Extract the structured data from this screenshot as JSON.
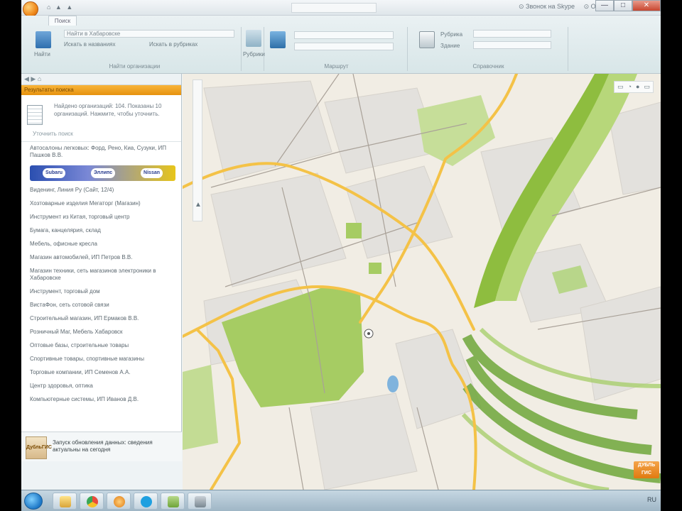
{
  "window": {
    "title": "",
    "quick_access": "⌂ ▲ ▲",
    "skype_controls": [
      "⊙ Звонок на Skype",
      "⊙ Отправить SMS"
    ],
    "buttons": {
      "minimize": "—",
      "maximize": "□",
      "close": "✕"
    }
  },
  "ribbon": {
    "tab_label": "Поиск",
    "groups": [
      {
        "label": "Найти организации",
        "button": "Найти",
        "field": "Найти в Хабаровске",
        "checkbox_1": "Искать в названиях",
        "checkbox_2": "Искать в рубриках"
      },
      {
        "label": "Рубрики",
        "button": "Рубрики"
      },
      {
        "label": "Маршрут",
        "button": "Маршрут",
        "field_from": "",
        "field_to": ""
      },
      {
        "label": "Справочник",
        "button": "Справка",
        "field_1": "Рубрика",
        "field_2": "Здание"
      }
    ]
  },
  "side_panel": {
    "toolbar_text": "◀ ▶ ⌂",
    "header": "Результаты поиска",
    "result": {
      "text": "Найдено организаций: 104. Показаны 10 организаций. Нажмите, чтобы уточнить.",
      "link": "Уточнить поиск"
    },
    "items": [
      "Автосалоны легковых: Форд, Рено, Киа, Сузуки, ИП Пашков В.В.",
      "Виденинг, Линия Ру (Сайт, 12/4)",
      "Хозтоварные изделия Мегаторг (Магазин)",
      "Инструмент из Китая, торговый центр",
      "Бумага, канцелярия, склад",
      "Мебель, офисные кресла",
      "Магазин автомобилей, ИП Петров В.В.",
      "Магазин техники, сеть магазинов электроники в Хабаровске",
      "Инструмент, торговый дом",
      "ВистаФон, сеть сотовой связи",
      "Строительный магазин, ИП Ермаков В.В.",
      "Розничный Маг, Мебель Хабаровск",
      "Оптовые базы, строительные товары",
      "Спортивные товары, спортивные магазины",
      "Торговые компании, ИП Семенов А.А.",
      "Центр здоровья, оптика",
      "Компьютерные системы, ИП Иванов Д.В."
    ],
    "banner_brands": [
      "Subaru",
      "Эллипс",
      "Nissan"
    ],
    "footer_logo": "ДубльГИС",
    "footer_text": "Запуск обновления данных: сведения актуальны на сегодня"
  },
  "map": {
    "tools": [
      "▭",
      "◔",
      "●",
      "▭"
    ],
    "logo_badge": "ДУБЛЬ ГИС"
  },
  "taskbar": {
    "items": [
      "explorer",
      "chrome",
      "orange",
      "skype",
      "folder",
      "contacts"
    ],
    "tray": "RU"
  },
  "colors": {
    "road_major": "#f4c247",
    "road_minor": "#a9a198",
    "park": "#a6cc63",
    "water": "#7fb3dd",
    "river_green": "#8ebd3f"
  }
}
